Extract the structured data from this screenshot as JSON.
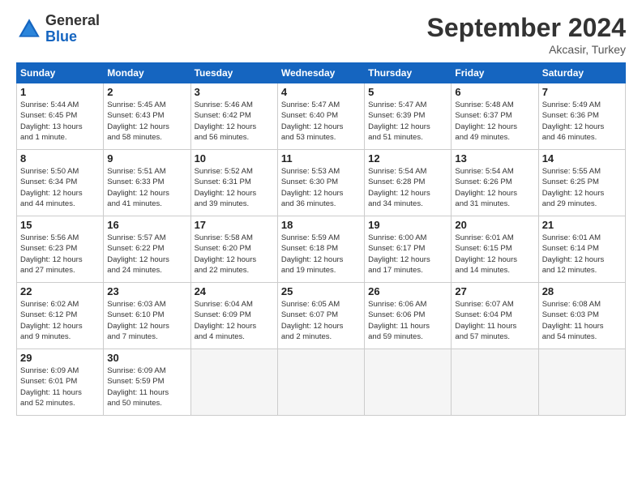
{
  "header": {
    "logo_general": "General",
    "logo_blue": "Blue",
    "title": "September 2024",
    "location": "Akcasir, Turkey"
  },
  "weekdays": [
    "Sunday",
    "Monday",
    "Tuesday",
    "Wednesday",
    "Thursday",
    "Friday",
    "Saturday"
  ],
  "weeks": [
    [
      {
        "day": "1",
        "detail": "Sunrise: 5:44 AM\nSunset: 6:45 PM\nDaylight: 13 hours\nand 1 minute."
      },
      {
        "day": "2",
        "detail": "Sunrise: 5:45 AM\nSunset: 6:43 PM\nDaylight: 12 hours\nand 58 minutes."
      },
      {
        "day": "3",
        "detail": "Sunrise: 5:46 AM\nSunset: 6:42 PM\nDaylight: 12 hours\nand 56 minutes."
      },
      {
        "day": "4",
        "detail": "Sunrise: 5:47 AM\nSunset: 6:40 PM\nDaylight: 12 hours\nand 53 minutes."
      },
      {
        "day": "5",
        "detail": "Sunrise: 5:47 AM\nSunset: 6:39 PM\nDaylight: 12 hours\nand 51 minutes."
      },
      {
        "day": "6",
        "detail": "Sunrise: 5:48 AM\nSunset: 6:37 PM\nDaylight: 12 hours\nand 49 minutes."
      },
      {
        "day": "7",
        "detail": "Sunrise: 5:49 AM\nSunset: 6:36 PM\nDaylight: 12 hours\nand 46 minutes."
      }
    ],
    [
      {
        "day": "8",
        "detail": "Sunrise: 5:50 AM\nSunset: 6:34 PM\nDaylight: 12 hours\nand 44 minutes."
      },
      {
        "day": "9",
        "detail": "Sunrise: 5:51 AM\nSunset: 6:33 PM\nDaylight: 12 hours\nand 41 minutes."
      },
      {
        "day": "10",
        "detail": "Sunrise: 5:52 AM\nSunset: 6:31 PM\nDaylight: 12 hours\nand 39 minutes."
      },
      {
        "day": "11",
        "detail": "Sunrise: 5:53 AM\nSunset: 6:30 PM\nDaylight: 12 hours\nand 36 minutes."
      },
      {
        "day": "12",
        "detail": "Sunrise: 5:54 AM\nSunset: 6:28 PM\nDaylight: 12 hours\nand 34 minutes."
      },
      {
        "day": "13",
        "detail": "Sunrise: 5:54 AM\nSunset: 6:26 PM\nDaylight: 12 hours\nand 31 minutes."
      },
      {
        "day": "14",
        "detail": "Sunrise: 5:55 AM\nSunset: 6:25 PM\nDaylight: 12 hours\nand 29 minutes."
      }
    ],
    [
      {
        "day": "15",
        "detail": "Sunrise: 5:56 AM\nSunset: 6:23 PM\nDaylight: 12 hours\nand 27 minutes."
      },
      {
        "day": "16",
        "detail": "Sunrise: 5:57 AM\nSunset: 6:22 PM\nDaylight: 12 hours\nand 24 minutes."
      },
      {
        "day": "17",
        "detail": "Sunrise: 5:58 AM\nSunset: 6:20 PM\nDaylight: 12 hours\nand 22 minutes."
      },
      {
        "day": "18",
        "detail": "Sunrise: 5:59 AM\nSunset: 6:18 PM\nDaylight: 12 hours\nand 19 minutes."
      },
      {
        "day": "19",
        "detail": "Sunrise: 6:00 AM\nSunset: 6:17 PM\nDaylight: 12 hours\nand 17 minutes."
      },
      {
        "day": "20",
        "detail": "Sunrise: 6:01 AM\nSunset: 6:15 PM\nDaylight: 12 hours\nand 14 minutes."
      },
      {
        "day": "21",
        "detail": "Sunrise: 6:01 AM\nSunset: 6:14 PM\nDaylight: 12 hours\nand 12 minutes."
      }
    ],
    [
      {
        "day": "22",
        "detail": "Sunrise: 6:02 AM\nSunset: 6:12 PM\nDaylight: 12 hours\nand 9 minutes."
      },
      {
        "day": "23",
        "detail": "Sunrise: 6:03 AM\nSunset: 6:10 PM\nDaylight: 12 hours\nand 7 minutes."
      },
      {
        "day": "24",
        "detail": "Sunrise: 6:04 AM\nSunset: 6:09 PM\nDaylight: 12 hours\nand 4 minutes."
      },
      {
        "day": "25",
        "detail": "Sunrise: 6:05 AM\nSunset: 6:07 PM\nDaylight: 12 hours\nand 2 minutes."
      },
      {
        "day": "26",
        "detail": "Sunrise: 6:06 AM\nSunset: 6:06 PM\nDaylight: 11 hours\nand 59 minutes."
      },
      {
        "day": "27",
        "detail": "Sunrise: 6:07 AM\nSunset: 6:04 PM\nDaylight: 11 hours\nand 57 minutes."
      },
      {
        "day": "28",
        "detail": "Sunrise: 6:08 AM\nSunset: 6:03 PM\nDaylight: 11 hours\nand 54 minutes."
      }
    ],
    [
      {
        "day": "29",
        "detail": "Sunrise: 6:09 AM\nSunset: 6:01 PM\nDaylight: 11 hours\nand 52 minutes."
      },
      {
        "day": "30",
        "detail": "Sunrise: 6:09 AM\nSunset: 5:59 PM\nDaylight: 11 hours\nand 50 minutes."
      },
      {
        "day": "",
        "detail": ""
      },
      {
        "day": "",
        "detail": ""
      },
      {
        "day": "",
        "detail": ""
      },
      {
        "day": "",
        "detail": ""
      },
      {
        "day": "",
        "detail": ""
      }
    ]
  ]
}
